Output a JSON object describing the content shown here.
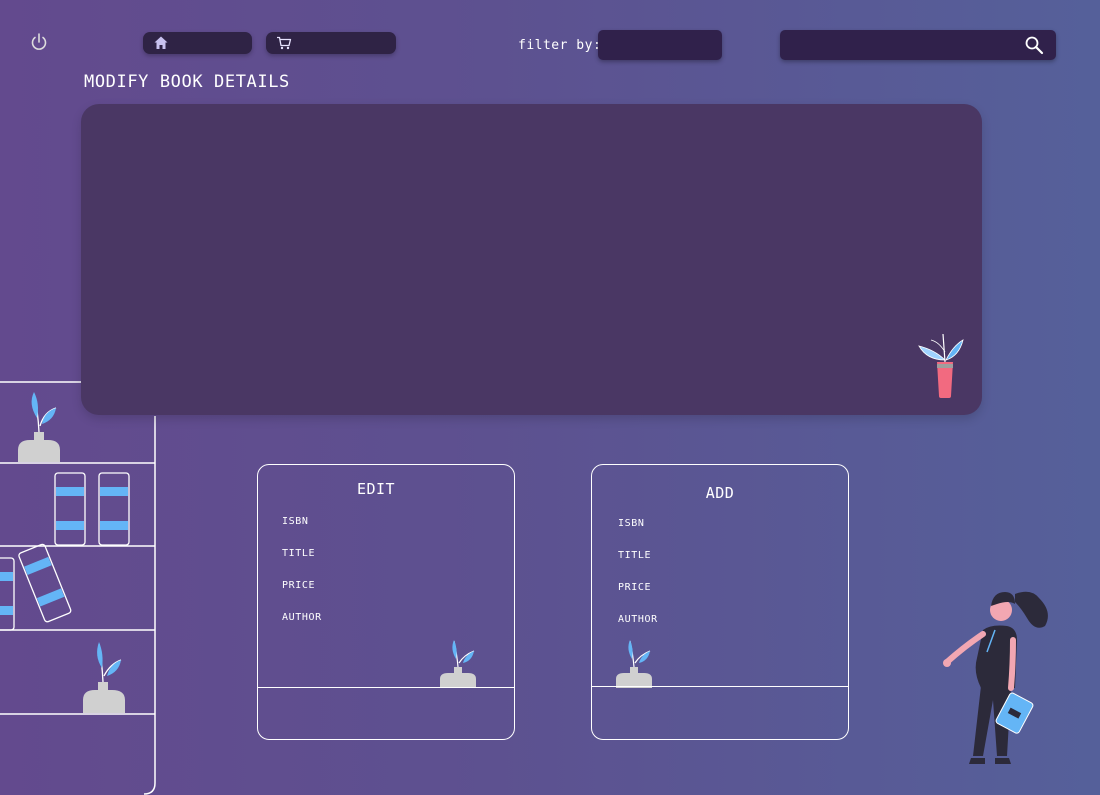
{
  "header": {
    "filter_label": "filter by:",
    "filter_value": "",
    "search_value": "",
    "search_placeholder": ""
  },
  "page": {
    "title": "MODIFY BOOK DETAILS"
  },
  "edit_form": {
    "title": "EDIT",
    "fields": [
      "ISBN",
      "TITLE",
      "PRICE",
      "AUTHOR"
    ]
  },
  "add_form": {
    "title": "ADD",
    "fields": [
      "ISBN",
      "TITLE",
      "PRICE",
      "AUTHOR"
    ]
  },
  "icons": {
    "power": "power-icon",
    "home": "home-icon",
    "cart": "cart-icon",
    "search": "search-icon"
  },
  "colors": {
    "nav_button": "#2f2345",
    "input_background": "#30214b",
    "panel": "#4a3764",
    "book_stripe": "#64b5f6",
    "plant_leaf": "#64b5f6",
    "pot_pink": "#f26a80",
    "vase_gray": "#d0d0d0"
  }
}
